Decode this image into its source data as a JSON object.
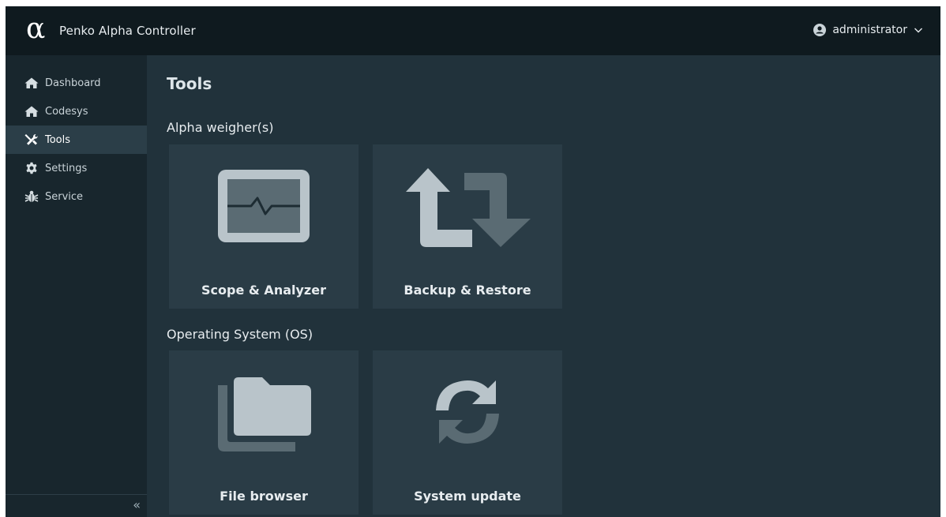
{
  "header": {
    "app_title": "Penko Alpha Controller",
    "user_name": "administrator",
    "logo_icon": "alpha-logo"
  },
  "sidebar": {
    "items": [
      {
        "label": "Dashboard",
        "icon": "home-icon",
        "active": false
      },
      {
        "label": "Codesys",
        "icon": "home-icon",
        "active": false
      },
      {
        "label": "Tools",
        "icon": "tools-icon",
        "active": true
      },
      {
        "label": "Settings",
        "icon": "gear-icon",
        "active": false
      },
      {
        "label": "Service",
        "icon": "bug-icon",
        "active": false
      }
    ],
    "collapse_glyph": "«"
  },
  "main": {
    "title": "Tools",
    "sections": [
      {
        "label": "Alpha weigher(s)",
        "tiles": [
          {
            "label": "Scope & Analyzer",
            "icon": "monitor-pulse-icon"
          },
          {
            "label": "Backup & Restore",
            "icon": "arrows-up-down-icon"
          }
        ]
      },
      {
        "label": "Operating System (OS)",
        "tiles": [
          {
            "label": "File browser",
            "icon": "folder-icon"
          },
          {
            "label": "System update",
            "icon": "sync-icon"
          }
        ]
      }
    ]
  },
  "colors": {
    "header_bg": "#0f1a1f",
    "sidebar_bg": "#18262d",
    "main_bg": "#21323b",
    "tile_bg": "#2a3c46",
    "active_nav_bg": "#2b3e48",
    "icon_light": "#b9c4ca",
    "icon_dark": "#5a6b73"
  }
}
